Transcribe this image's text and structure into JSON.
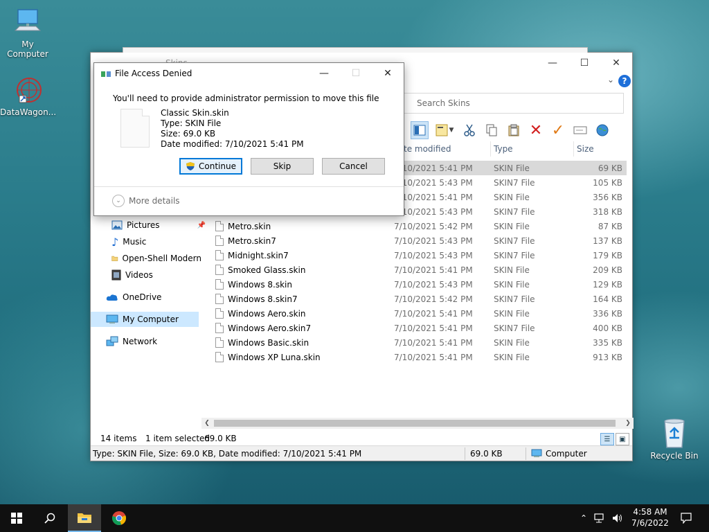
{
  "desktop": {
    "icons": [
      {
        "label": "My Computer"
      },
      {
        "label": "DataWagon..."
      },
      {
        "label": "Recycle Bin"
      }
    ]
  },
  "explorer": {
    "title": "Skins",
    "search_placeholder": "Search Skins",
    "columns": {
      "date": "te modified",
      "type": "Type",
      "size": "Size"
    },
    "nav": [
      {
        "label": "Pictures"
      },
      {
        "label": "Music"
      },
      {
        "label": "Open-Shell Modern"
      },
      {
        "label": "Videos"
      },
      {
        "label": "OneDrive"
      },
      {
        "label": "My Computer"
      },
      {
        "label": "Network"
      }
    ],
    "files": [
      {
        "name": "",
        "date": "7/10/2021 5:41 PM",
        "type": "SKIN File",
        "size": "69 KB"
      },
      {
        "name": "",
        "date": "7/10/2021 5:43 PM",
        "type": "SKIN7 File",
        "size": "105 KB"
      },
      {
        "name": "",
        "date": "7/10/2021 5:41 PM",
        "type": "SKIN File",
        "size": "356 KB"
      },
      {
        "name": "",
        "date": "7/10/2021 5:43 PM",
        "type": "SKIN7 File",
        "size": "318 KB"
      },
      {
        "name": "Metro.skin",
        "date": "7/10/2021 5:42 PM",
        "type": "SKIN File",
        "size": "87 KB"
      },
      {
        "name": "Metro.skin7",
        "date": "7/10/2021 5:43 PM",
        "type": "SKIN7 File",
        "size": "137 KB"
      },
      {
        "name": "Midnight.skin7",
        "date": "7/10/2021 5:43 PM",
        "type": "SKIN7 File",
        "size": "179 KB"
      },
      {
        "name": "Smoked Glass.skin",
        "date": "7/10/2021 5:41 PM",
        "type": "SKIN File",
        "size": "209 KB"
      },
      {
        "name": "Windows 8.skin",
        "date": "7/10/2021 5:43 PM",
        "type": "SKIN File",
        "size": "129 KB"
      },
      {
        "name": "Windows 8.skin7",
        "date": "7/10/2021 5:42 PM",
        "type": "SKIN7 File",
        "size": "164 KB"
      },
      {
        "name": "Windows Aero.skin",
        "date": "7/10/2021 5:41 PM",
        "type": "SKIN File",
        "size": "336 KB"
      },
      {
        "name": "Windows Aero.skin7",
        "date": "7/10/2021 5:41 PM",
        "type": "SKIN7 File",
        "size": "400 KB"
      },
      {
        "name": "Windows Basic.skin",
        "date": "7/10/2021 5:41 PM",
        "type": "SKIN File",
        "size": "335 KB"
      },
      {
        "name": "Windows XP Luna.skin",
        "date": "7/10/2021 5:41 PM",
        "type": "SKIN File",
        "size": "913 KB"
      }
    ],
    "item_count": "14 items",
    "selection": "1 item selected",
    "selection_size": "69.0 KB",
    "status": {
      "details": "Type: SKIN File, Size: 69.0 KB, Date modified: 7/10/2021 5:41 PM",
      "size": "69.0 KB",
      "location": "Computer"
    }
  },
  "dialog": {
    "title": "File Access Denied",
    "message": "You'll need to provide administrator permission to move this file",
    "file_name": "Classic Skin.skin",
    "file_type": "Type: SKIN File",
    "file_size": "Size: 69.0 KB",
    "file_modified": "Date modified: 7/10/2021 5:41 PM",
    "continue_label": "Continue",
    "skip_label": "Skip",
    "cancel_label": "Cancel",
    "more_details_label": "More details"
  },
  "taskbar": {
    "time": "4:58 AM",
    "date": "7/6/2022"
  }
}
